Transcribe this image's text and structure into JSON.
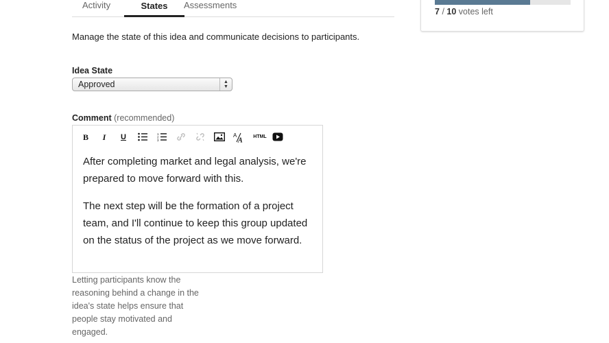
{
  "tabs": [
    {
      "label": "Activity",
      "active": false
    },
    {
      "label": "States",
      "active": true
    },
    {
      "label": "Assessments",
      "active": false
    }
  ],
  "description": "Manage the state of this idea and communicate decisions to participants.",
  "idea_state": {
    "label": "Idea State",
    "selected": "Approved"
  },
  "comment": {
    "label": "Comment",
    "hint": "(recommended)",
    "toolbar": [
      {
        "icon": "bold-icon",
        "glyph": "B"
      },
      {
        "icon": "italic-icon",
        "glyph": "I"
      },
      {
        "icon": "underline-icon",
        "glyph": "U"
      },
      {
        "icon": "bulleted-list-icon"
      },
      {
        "icon": "numbered-list-icon"
      },
      {
        "icon": "link-icon"
      },
      {
        "icon": "unlink-icon"
      },
      {
        "icon": "image-icon"
      },
      {
        "icon": "font-size-icon"
      },
      {
        "icon": "html-icon",
        "glyph": "HTML"
      },
      {
        "icon": "video-icon"
      }
    ],
    "paragraphs": [
      "After completing market and legal analysis, we're prepared to move forward with this.",
      "The next step will be the formation of a project team, and I'll continue to keep this group updated on the status of the project as we move forward."
    ],
    "help_text": "Letting participants know the reasoning behind a change in the idea's state helps ensure that people stay motivated and engaged."
  },
  "votes": {
    "used": "7",
    "separator": "/",
    "total": "10",
    "suffix": "votes left",
    "fill_fraction": 0.7,
    "fill_color": "#5a7a93"
  }
}
